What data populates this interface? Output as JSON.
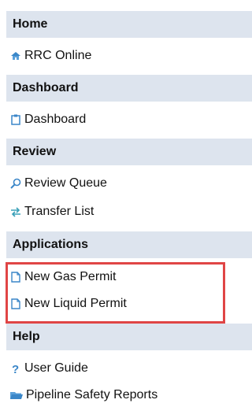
{
  "sections": {
    "home": {
      "header": "Home",
      "items": [
        {
          "label": "RRC Online",
          "icon": "home-icon"
        }
      ]
    },
    "dashboard": {
      "header": "Dashboard",
      "items": [
        {
          "label": "Dashboard",
          "icon": "clipboard-icon"
        }
      ]
    },
    "review": {
      "header": "Review",
      "items": [
        {
          "label": "Review Queue",
          "icon": "search-icon"
        },
        {
          "label": "Transfer List",
          "icon": "transfer-arrows-icon"
        }
      ]
    },
    "applications": {
      "header": "Applications",
      "items": [
        {
          "label": "New Gas Permit",
          "icon": "document-icon"
        },
        {
          "label": "New Liquid Permit",
          "icon": "document-icon"
        }
      ]
    },
    "help": {
      "header": "Help",
      "items": [
        {
          "label": "User Guide",
          "icon": "question-icon"
        },
        {
          "label": "Pipeline Safety Reports",
          "icon": "folder-icon"
        }
      ]
    }
  },
  "colors": {
    "header_bg": "#dde4ee",
    "highlight_border": "#e04545",
    "icon_blue": "#3a86c8"
  }
}
